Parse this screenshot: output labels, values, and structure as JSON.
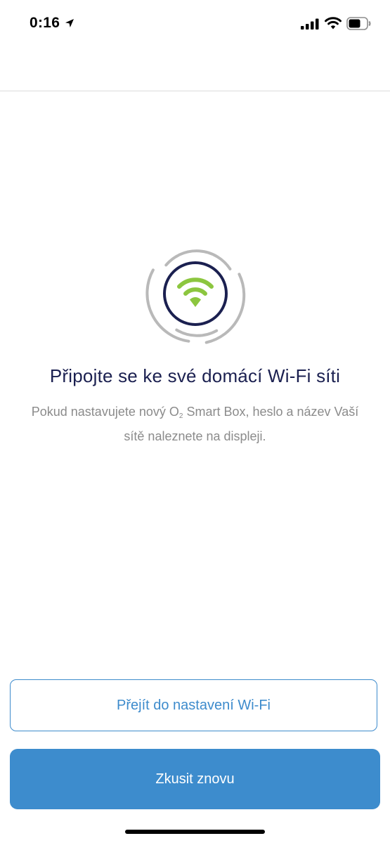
{
  "status_bar": {
    "time": "0:16",
    "icons": [
      "location-arrow-icon",
      "cellular-signal-icon",
      "wifi-icon",
      "battery-icon"
    ]
  },
  "main": {
    "hero_icon": "wifi-icon",
    "title": "Připojte se ke své domácí Wi-Fi síti",
    "description_part1": "Pokud nastavujete nový O",
    "description_subscript": "2",
    "description_part2": " Smart Box, heslo a název Vaší sítě naleznete na displeji."
  },
  "actions": {
    "secondary_label": "Přejít do nastavení Wi-Fi",
    "primary_label": "Zkusit znovu"
  },
  "colors": {
    "title": "#1b2050",
    "accent": "#3d8ccd",
    "wifi_green": "#8cc63f",
    "description": "#8b8b8b",
    "ring_gray": "#b9b9b9"
  }
}
